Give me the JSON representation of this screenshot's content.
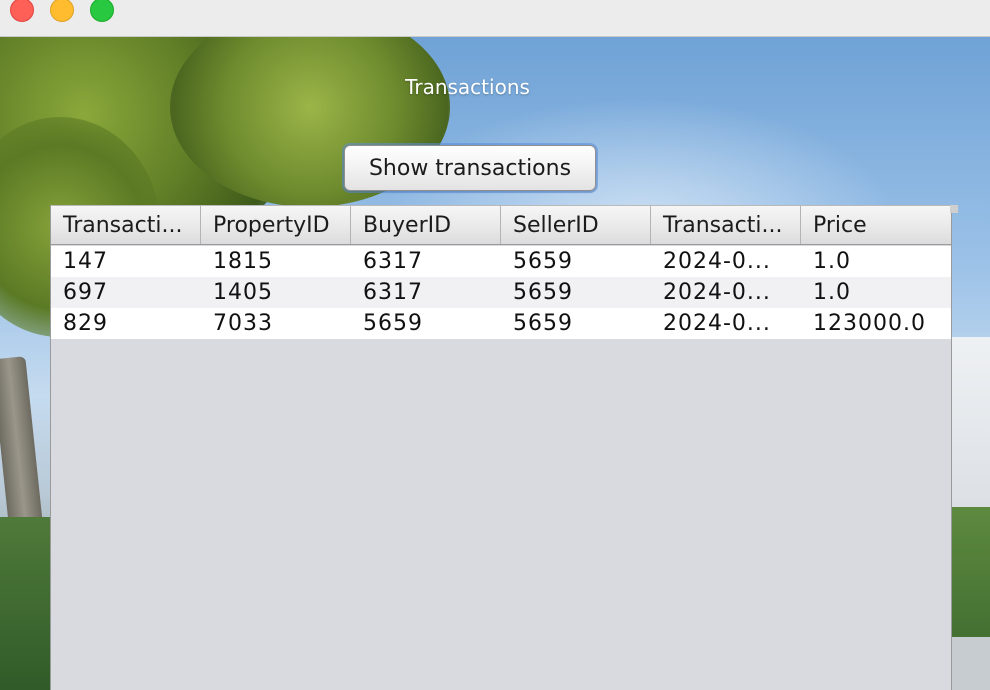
{
  "window": {
    "title": "Transactions"
  },
  "toolbar": {
    "show_button_label": "Show transactions"
  },
  "table": {
    "columns": [
      "Transacti...",
      "PropertyID",
      "BuyerID",
      "SellerID",
      "Transacti...",
      "Price"
    ],
    "rows": [
      [
        "147",
        "1815",
        "6317",
        "5659",
        "2024-0...",
        "1.0"
      ],
      [
        "697",
        "1405",
        "6317",
        "5659",
        "2024-0...",
        "1.0"
      ],
      [
        "829",
        "7033",
        "5659",
        "5659",
        "2024-0...",
        "123000.0"
      ]
    ]
  },
  "colors": {
    "close": "#fe5f57",
    "minimize": "#febc2e",
    "maximize": "#28c840",
    "table_empty_bg": "#d8dae0"
  }
}
